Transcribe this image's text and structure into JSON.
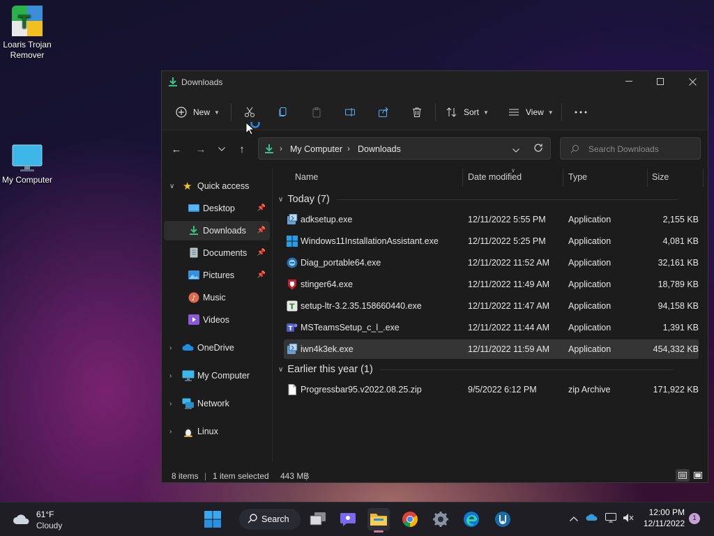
{
  "desktop": {
    "icons": [
      {
        "label": "Loaris Trojan Remover"
      },
      {
        "label": "My Computer"
      }
    ]
  },
  "window": {
    "title": "Downloads",
    "toolbar": {
      "new_label": "New",
      "sort_label": "Sort",
      "view_label": "View"
    },
    "breadcrumb": [
      "My Computer",
      "Downloads"
    ],
    "search_placeholder": "Search Downloads",
    "sidebar": {
      "quick_access": "Quick access",
      "items": [
        {
          "label": "Desktop",
          "pinned": true
        },
        {
          "label": "Downloads",
          "pinned": true
        },
        {
          "label": "Documents",
          "pinned": true
        },
        {
          "label": "Pictures",
          "pinned": true
        },
        {
          "label": "Music",
          "pinned": false
        },
        {
          "label": "Videos",
          "pinned": false
        }
      ],
      "roots": [
        {
          "label": "OneDrive"
        },
        {
          "label": "My Computer"
        },
        {
          "label": "Network"
        },
        {
          "label": "Linux"
        }
      ]
    },
    "columns": [
      "Name",
      "Date modified",
      "Type",
      "Size"
    ],
    "groups": [
      {
        "label": "Today (7)",
        "files": [
          {
            "name": "adksetup.exe",
            "date": "12/11/2022 5:55 PM",
            "type": "Application",
            "size": "2,155 KB",
            "icon": "installer-icon"
          },
          {
            "name": "Windows11InstallationAssistant.exe",
            "date": "12/11/2022 5:25 PM",
            "type": "Application",
            "size": "4,081 KB",
            "icon": "windows-logo-icon"
          },
          {
            "name": "Diag_portable64.exe",
            "date": "12/11/2022 11:52 AM",
            "type": "Application",
            "size": "32,161 KB",
            "icon": "diag-icon"
          },
          {
            "name": "stinger64.exe",
            "date": "12/11/2022 11:49 AM",
            "type": "Application",
            "size": "18,789 KB",
            "icon": "stinger-icon"
          },
          {
            "name": "setup-ltr-3.2.35.158660440.exe",
            "date": "12/11/2022 11:47 AM",
            "type": "Application",
            "size": "94,158 KB",
            "icon": "loaris-setup-icon"
          },
          {
            "name": "MSTeamsSetup_c_l_.exe",
            "date": "12/11/2022 11:44 AM",
            "type": "Application",
            "size": "1,391 KB",
            "icon": "teams-icon"
          },
          {
            "name": "iwn4k3ek.exe",
            "date": "12/11/2022 11:59 AM",
            "type": "Application",
            "size": "454,332 KB",
            "icon": "installer-icon",
            "selected": true
          }
        ]
      },
      {
        "label": "Earlier this year (1)",
        "files": [
          {
            "name": "Progressbar95.v2022.08.25.zip",
            "date": "9/5/2022 6:12 PM",
            "type": "zip Archive",
            "size": "171,922 KB",
            "icon": "zip-file-icon"
          }
        ]
      }
    ],
    "status": {
      "items": "8 items",
      "selected": "1 item selected",
      "size": "443 MB"
    }
  },
  "taskbar": {
    "weather": {
      "temp": "61°F",
      "condition": "Cloudy"
    },
    "search_label": "Search",
    "clock": {
      "time": "12:00 PM",
      "date": "12/11/2022"
    },
    "notification_count": "1"
  },
  "colors": {
    "accent": "#0078d4",
    "window_bg": "#1c1c1c",
    "selection": "#353535"
  }
}
